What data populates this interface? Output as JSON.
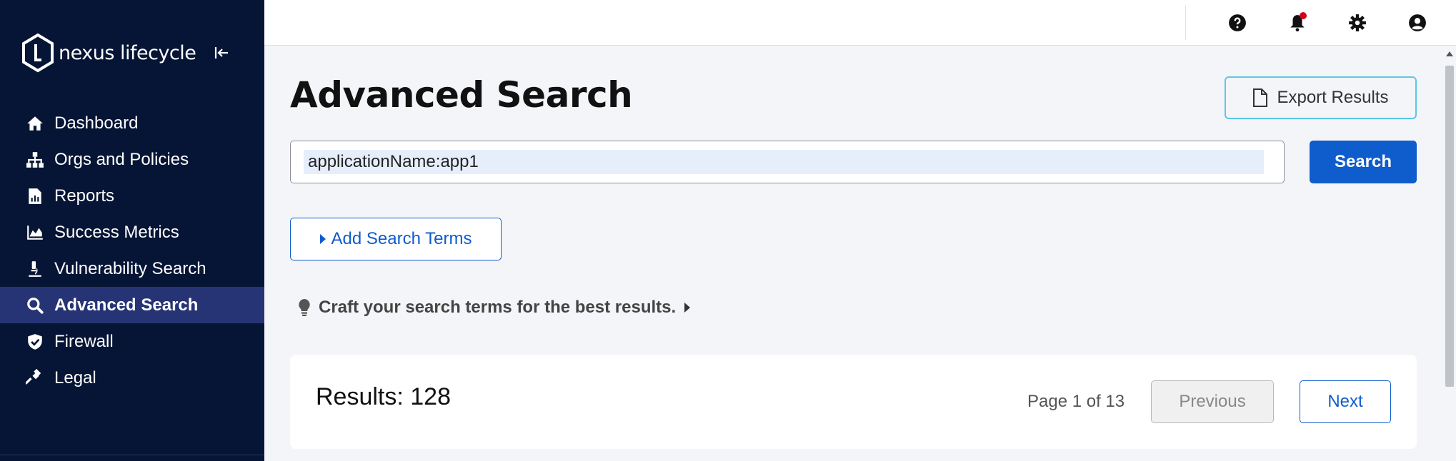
{
  "brand": {
    "name": "nexus lifecycle"
  },
  "sidebar": {
    "items": [
      {
        "label": "Dashboard",
        "icon": "home-icon"
      },
      {
        "label": "Orgs and Policies",
        "icon": "org-tree-icon"
      },
      {
        "label": "Reports",
        "icon": "report-icon"
      },
      {
        "label": "Success Metrics",
        "icon": "chart-icon"
      },
      {
        "label": "Vulnerability Search",
        "icon": "microscope-icon"
      },
      {
        "label": "Advanced Search",
        "icon": "search-icon",
        "active": true
      },
      {
        "label": "Firewall",
        "icon": "shield-check-icon"
      },
      {
        "label": "Legal",
        "icon": "gavel-icon"
      }
    ]
  },
  "topbar": {
    "icons": [
      "help-icon",
      "bell-icon",
      "gear-icon",
      "user-icon"
    ],
    "has_notification": true
  },
  "main": {
    "title": "Advanced Search",
    "export_label": "Export Results",
    "search": {
      "value": "applicationName:app1",
      "button_label": "Search"
    },
    "add_terms_label": "Add Search Terms",
    "tip_text": "Craft your search terms for the best results.",
    "results": {
      "label": "Results: 128",
      "page_info": "Page 1 of 13",
      "previous_label": "Previous",
      "next_label": "Next"
    }
  },
  "colors": {
    "sidebar_bg": "#061535",
    "sidebar_active": "#263475",
    "primary": "#0f5ccd",
    "export_border": "#59c8e6",
    "notification": "#d0021b"
  }
}
